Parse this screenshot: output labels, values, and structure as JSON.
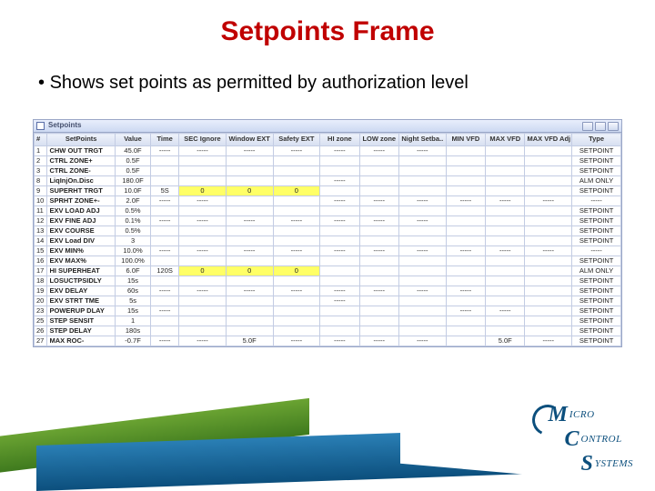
{
  "slide": {
    "title": "Setpoints Frame",
    "bullet": "Shows set points as permitted by authorization level"
  },
  "frame": {
    "title": "Setpoints"
  },
  "columns": [
    "#",
    "SetPoints",
    "Value",
    "Time",
    "SEC Ignore",
    "Window EXT",
    "Safety EXT",
    "HI zone",
    "LOW zone",
    "Night Setba..",
    "MIN VFD",
    "MAX VFD",
    "MAX VFD Adj",
    "Type"
  ],
  "rows": [
    {
      "n": "1",
      "name": "CHW OUT TRGT",
      "val": "45.0F",
      "t": "-----",
      "c": [
        "-----",
        "-----",
        "-----",
        "-----",
        "-----",
        "-----",
        "",
        "",
        "",
        "SETPOINT"
      ]
    },
    {
      "n": "2",
      "name": "CTRL ZONE+",
      "val": "0.5F",
      "t": "",
      "c": [
        "",
        "",
        "",
        "",
        "",
        "",
        "",
        "",
        "",
        "SETPOINT"
      ]
    },
    {
      "n": "3",
      "name": "CTRL ZONE-",
      "val": "0.5F",
      "t": "",
      "c": [
        "",
        "",
        "",
        "",
        "",
        "",
        "",
        "",
        "",
        "SETPOINT"
      ]
    },
    {
      "n": "8",
      "name": "LiqInjOn.Disc",
      "val": "180.0F",
      "t": "",
      "c": [
        "",
        "",
        "",
        "-----",
        "",
        "",
        "",
        "",
        "",
        "ALM ONLY"
      ]
    },
    {
      "n": "9",
      "name": "SUPERHT TRGT",
      "val": "10.0F",
      "t": "5S",
      "c": [
        "0",
        "0",
        "0",
        "",
        "",
        "",
        "",
        "",
        "",
        "SETPOINT",
        "hl"
      ]
    },
    {
      "n": "10",
      "name": "SPRHT ZONE+-",
      "val": "2.0F",
      "t": "-----",
      "c": [
        "-----",
        "",
        "",
        "-----",
        "-----",
        "-----",
        "-----",
        "-----",
        "-----",
        "-----"
      ]
    },
    {
      "n": "11",
      "name": "EXV LOAD ADJ",
      "val": "0.5%",
      "t": "",
      "c": [
        "",
        "",
        "",
        "",
        "",
        "",
        "",
        "",
        "",
        "SETPOINT"
      ]
    },
    {
      "n": "12",
      "name": "EXV FINE ADJ",
      "val": "0.1%",
      "t": "-----",
      "c": [
        "-----",
        "-----",
        "-----",
        "-----",
        "-----",
        "-----",
        "",
        "",
        "",
        "SETPOINT"
      ]
    },
    {
      "n": "13",
      "name": "EXV COURSE",
      "val": "0.5%",
      "t": "",
      "c": [
        "",
        "",
        "",
        "",
        "",
        "",
        "",
        "",
        "",
        "SETPOINT"
      ]
    },
    {
      "n": "14",
      "name": "EXV Load DIV",
      "val": "3",
      "t": "",
      "c": [
        "",
        "",
        "",
        "",
        "",
        "",
        "",
        "",
        "",
        "SETPOINT"
      ]
    },
    {
      "n": "15",
      "name": "EXV MIN%",
      "val": "10.0%",
      "t": "-----",
      "c": [
        "-----",
        "-----",
        "-----",
        "-----",
        "-----",
        "-----",
        "-----",
        "-----",
        "-----",
        "-----"
      ]
    },
    {
      "n": "16",
      "name": "EXV MAX%",
      "val": "100.0%",
      "t": "",
      "c": [
        "",
        "",
        "",
        "",
        "",
        "",
        "",
        "",
        "",
        "SETPOINT"
      ]
    },
    {
      "n": "17",
      "name": "HI SUPERHEAT",
      "val": "6.0F",
      "t": "120S",
      "c": [
        "0",
        "0",
        "0",
        "",
        "",
        "",
        "",
        "",
        "",
        "ALM ONLY",
        "hl"
      ]
    },
    {
      "n": "18",
      "name": "LOSUCTPSIDLY",
      "val": "15s",
      "t": "",
      "c": [
        "",
        "",
        "",
        "",
        "",
        "",
        "",
        "",
        "",
        "SETPOINT"
      ]
    },
    {
      "n": "19",
      "name": "EXV DELAY",
      "val": "60s",
      "t": "-----",
      "c": [
        "-----",
        "-----",
        "-----",
        "-----",
        "-----",
        "-----",
        "-----",
        "",
        "",
        "SETPOINT"
      ]
    },
    {
      "n": "20",
      "name": "EXV STRT TME",
      "val": "5s",
      "t": "",
      "c": [
        "",
        "",
        "",
        "-----",
        "",
        "",
        "",
        "",
        "",
        "SETPOINT"
      ]
    },
    {
      "n": "23",
      "name": "POWERUP DLAY",
      "val": "15s",
      "t": "-----",
      "c": [
        "",
        "",
        "",
        "",
        "",
        "",
        "-----",
        "-----",
        "",
        "SETPOINT"
      ]
    },
    {
      "n": "25",
      "name": "STEP SENSIT",
      "val": "1",
      "t": "",
      "c": [
        "",
        "",
        "",
        "",
        "",
        "",
        "",
        "",
        "",
        "SETPOINT"
      ]
    },
    {
      "n": "26",
      "name": "STEP DELAY",
      "val": "180s",
      "t": "",
      "c": [
        "",
        "",
        "",
        "",
        "",
        "",
        "",
        "",
        "",
        "SETPOINT"
      ]
    },
    {
      "n": "27",
      "name": "MAX ROC-",
      "val": "-0.7F",
      "t": "-----",
      "c": [
        "-----",
        "5.0F",
        "-----",
        "-----",
        "-----",
        "-----",
        "",
        "5.0F",
        "-----",
        "SETPOINT"
      ]
    }
  ],
  "logo": {
    "big_m": "M",
    "l1": "ICRO",
    "big_c": "C",
    "l2": "ONTROL",
    "big_s": "S",
    "l3": "YSTEMS"
  }
}
